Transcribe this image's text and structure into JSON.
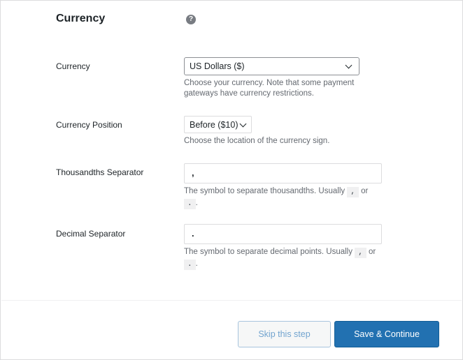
{
  "section": {
    "title": "Currency",
    "help_icon": "question-circle-icon",
    "help_glyph": "?"
  },
  "fields": {
    "currency": {
      "label": "Currency",
      "value": "US Dollars ($)",
      "description": "Choose your currency. Note that some payment gateways have currency restrictions."
    },
    "currency_position": {
      "label": "Currency Position",
      "value": "Before ($10)",
      "description": "Choose the location of the currency sign."
    },
    "thousandths_separator": {
      "label": "Thousandths Separator",
      "value": ",",
      "description_prefix": "The symbol to separate thousandths. Usually",
      "code_1": ",",
      "or": "or",
      "code_2": ".",
      "period": "."
    },
    "decimal_separator": {
      "label": "Decimal Separator",
      "value": ".",
      "description_prefix": "The symbol to separate decimal points. Usually",
      "code_1": ",",
      "or": "or",
      "code_2": ".",
      "period": "."
    }
  },
  "footer": {
    "skip_label": "Skip this step",
    "save_label": "Save & Continue"
  },
  "colors": {
    "primary": "#2271b1",
    "skip_text": "#72a4cf",
    "help_icon": "#787c82"
  }
}
